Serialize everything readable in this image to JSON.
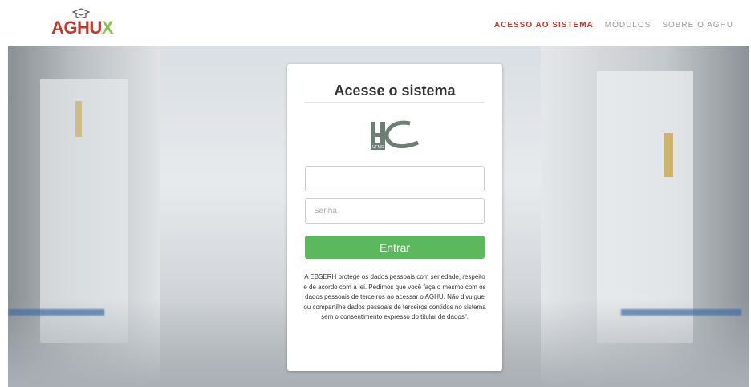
{
  "brand": {
    "logo_main": "AGHU",
    "logo_x": "X"
  },
  "nav": {
    "items": [
      {
        "label": "ACESSO AO SISTEMA",
        "active": true
      },
      {
        "label": "MÓDULOS",
        "active": false
      },
      {
        "label": "SOBRE O AGHU",
        "active": false
      }
    ]
  },
  "login": {
    "title": "Acesse o sistema",
    "hospital_logo": {
      "letters": "HC",
      "caption": "UFMG"
    },
    "username": {
      "value": "",
      "placeholder": ""
    },
    "password": {
      "value": "",
      "placeholder": "Senha"
    },
    "submit_label": "Entrar",
    "notice": "A EBSERH protege os dados pessoais com seriedade, respeito e de acordo com a lei. Pedimos que você faça o mesmo com os dados pessoais de terceiros ao acessar o AGHU. Não divulgue ou compartilhe dados pessoais de terceiros contidos no sistema sem o consentimento expresso do titular de dados\"."
  },
  "colors": {
    "brand_red": "#c0392b",
    "brand_green": "#8bc34a",
    "button_green": "#5cb85c",
    "nav_gray": "#9a9a9a"
  },
  "icons": {
    "logo_cap": "graduation-cap-icon"
  }
}
